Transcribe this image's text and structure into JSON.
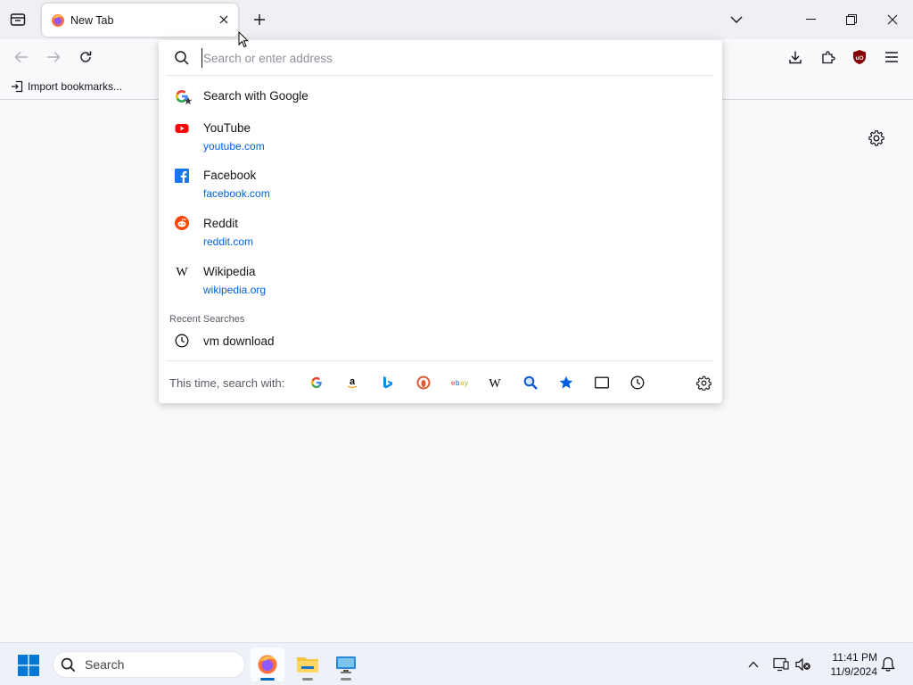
{
  "tab": {
    "title": "New Tab"
  },
  "bookmarks": {
    "import_label": "Import bookmarks..."
  },
  "urlbar": {
    "placeholder": "Search or enter address"
  },
  "results": {
    "search_suggestion": "Search with Google",
    "shortcuts": [
      {
        "title": "YouTube",
        "url": "youtube.com",
        "icon": "youtube-icon",
        "color": "#ff0000"
      },
      {
        "title": "Facebook",
        "url": "facebook.com",
        "icon": "facebook-icon",
        "color": "#1877f2"
      },
      {
        "title": "Reddit",
        "url": "reddit.com",
        "icon": "reddit-icon",
        "color": "#ff4500"
      },
      {
        "title": "Wikipedia",
        "url": "wikipedia.org",
        "icon": "wikipedia-icon",
        "color": "#000000"
      }
    ],
    "recent_label": "Recent Searches",
    "recent": [
      {
        "title": "vm download",
        "icon": "history-icon"
      }
    ]
  },
  "oneoff": {
    "label": "This time, search with:",
    "engines": [
      "google",
      "amazon",
      "bing",
      "duckduckgo",
      "ebay",
      "wikipedia",
      "search",
      "bookmarks",
      "tabs",
      "history"
    ]
  },
  "taskbar": {
    "search_label": "Search",
    "time": "11:41 PM",
    "date": "11/9/2024",
    "accent": "#0067c0"
  }
}
